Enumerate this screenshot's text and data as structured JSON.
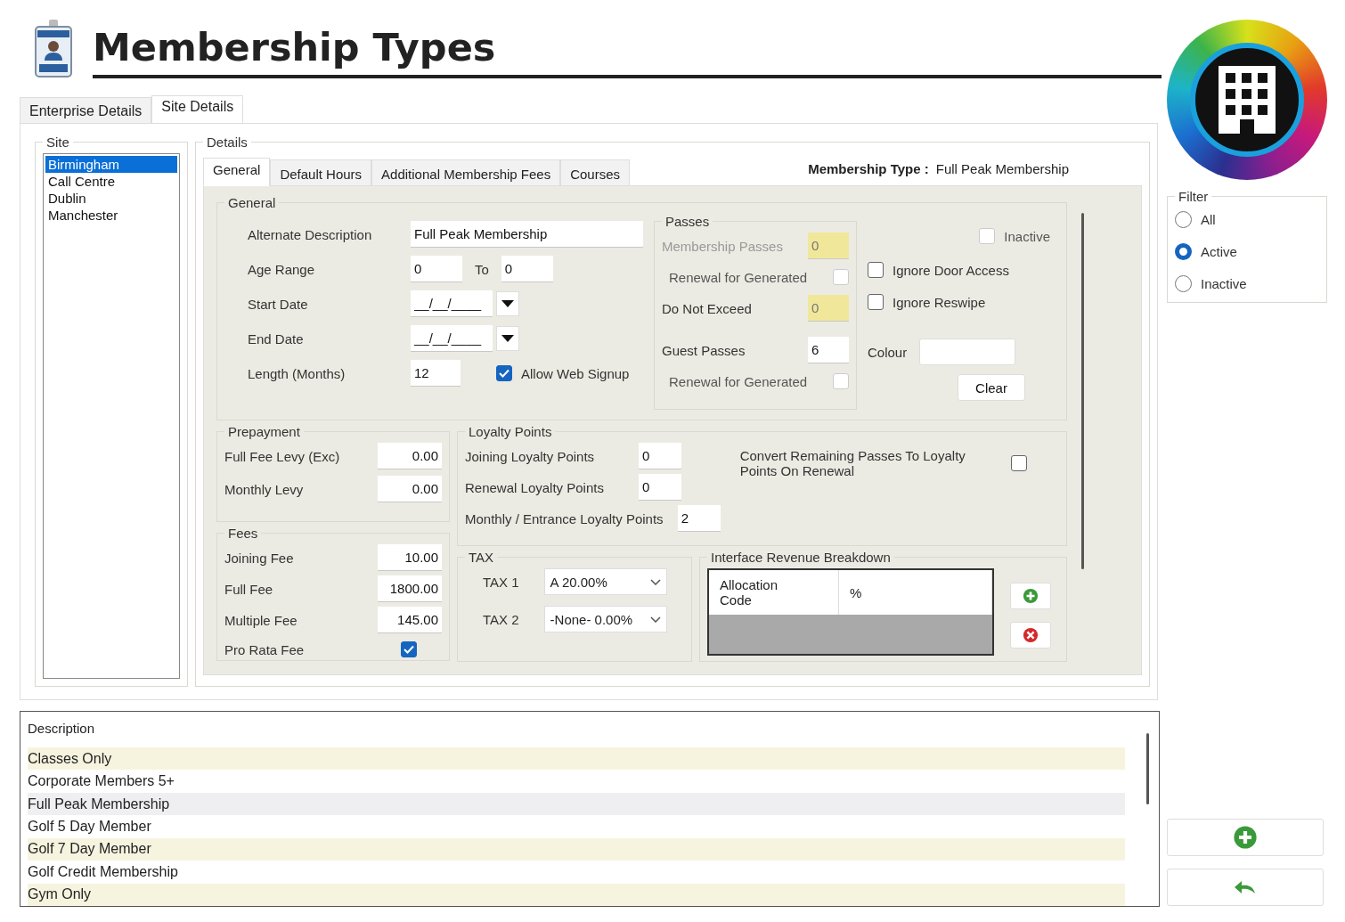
{
  "title": "Membership Types",
  "tabs": [
    {
      "label": "Enterprise Details",
      "selected": false
    },
    {
      "label": "Site Details",
      "selected": true
    }
  ],
  "site": {
    "label": "Site",
    "items": [
      {
        "label": "Birmingham",
        "selected": true
      },
      {
        "label": "Call Centre",
        "selected": false
      },
      {
        "label": "Dublin",
        "selected": false
      },
      {
        "label": "Manchester",
        "selected": false
      }
    ]
  },
  "details": {
    "label": "Details",
    "tabs": [
      {
        "label": "General",
        "selected": true
      },
      {
        "label": "Default Hours",
        "selected": false
      },
      {
        "label": "Additional Membership Fees",
        "selected": false
      },
      {
        "label": "Courses",
        "selected": false
      }
    ],
    "membership_type": {
      "label": "Membership Type :",
      "value": "Full Peak Membership"
    }
  },
  "general": {
    "label": "General",
    "fields": [
      {
        "kind": "text",
        "label": "Alternate Description",
        "value": "Full Peak Membership"
      },
      {
        "kind": "range",
        "label": "Age Range",
        "value": "0",
        "to_label": "To",
        "to_value": "0"
      },
      {
        "kind": "date",
        "label": "Start Date",
        "value": "__/__/____"
      },
      {
        "kind": "date",
        "label": "End Date",
        "value": "__/__/____"
      },
      {
        "kind": "number",
        "label": "Length (Months)",
        "value": "12",
        "option": {
          "label": "Allow Web Signup",
          "checked": true
        }
      }
    ]
  },
  "passes": {
    "label": "Passes",
    "rows": [
      {
        "kind": "field",
        "label": "Membership Passes",
        "value": "0",
        "disabled": true,
        "readonly": true
      },
      {
        "kind": "checkbox",
        "label": "Renewal for Generated",
        "checked": false
      },
      {
        "kind": "field",
        "label": "Do Not Exceed",
        "value": "0",
        "disabled": false,
        "readonly": true
      },
      {
        "kind": "field",
        "label": "Guest Passes",
        "value": "6",
        "disabled": false,
        "readonly": false
      },
      {
        "kind": "checkbox",
        "label": "Renewal for Generated",
        "checked": false
      }
    ]
  },
  "flags": [
    {
      "label": "Inactive",
      "checked": false,
      "disabled": true
    },
    {
      "label": "Ignore Door Access",
      "checked": false,
      "disabled": false
    },
    {
      "label": "Ignore Reswipe",
      "checked": false,
      "disabled": false
    }
  ],
  "colour": {
    "label": "Colour",
    "button": "Clear"
  },
  "prepayment": {
    "label": "Prepayment",
    "fields": [
      {
        "label": "Full Fee Levy (Exc)",
        "value": "0.00"
      },
      {
        "label": "Monthly Levy",
        "value": "0.00"
      }
    ]
  },
  "fees": {
    "label": "Fees",
    "rows": [
      {
        "kind": "field",
        "label": "Joining Fee",
        "value": "10.00"
      },
      {
        "kind": "field",
        "label": "Full Fee",
        "value": "1800.00"
      },
      {
        "kind": "field",
        "label": "Multiple Fee",
        "value": "145.00"
      },
      {
        "kind": "checkbox",
        "label": "Pro Rata Fee",
        "checked": true
      }
    ]
  },
  "loyalty": {
    "label": "Loyalty Points",
    "fields": [
      {
        "label": "Joining Loyalty Points",
        "value": "0"
      },
      {
        "label": "Renewal Loyalty Points",
        "value": "0"
      },
      {
        "label": "Monthly / Entrance Loyalty Points",
        "value": "2"
      }
    ],
    "convert": {
      "label": "Convert Remaining Passes To Loyalty Points On Renewal",
      "checked": false
    }
  },
  "tax": {
    "label": "TAX",
    "rows": [
      {
        "label": "TAX 1",
        "value": "A 20.00%"
      },
      {
        "label": "TAX 2",
        "value": "-None- 0.00%"
      }
    ]
  },
  "revenue": {
    "label": "Interface Revenue Breakdown",
    "columns": [
      "Allocation Code",
      "%"
    ]
  },
  "list": {
    "header": "Description",
    "rows": [
      {
        "label": "Classes Only",
        "selected": false
      },
      {
        "label": "Corporate Members 5+",
        "selected": false
      },
      {
        "label": "Full Peak Membership",
        "selected": true
      },
      {
        "label": "Golf 5 Day Member",
        "selected": false
      },
      {
        "label": "Golf 7 Day Member",
        "selected": false
      },
      {
        "label": "Golf Credit Membership",
        "selected": false
      },
      {
        "label": "Gym Only",
        "selected": false
      }
    ]
  },
  "filter": {
    "label": "Filter",
    "options": [
      {
        "label": "All",
        "selected": false
      },
      {
        "label": "Active",
        "selected": true
      },
      {
        "label": "Inactive",
        "selected": false
      }
    ]
  }
}
